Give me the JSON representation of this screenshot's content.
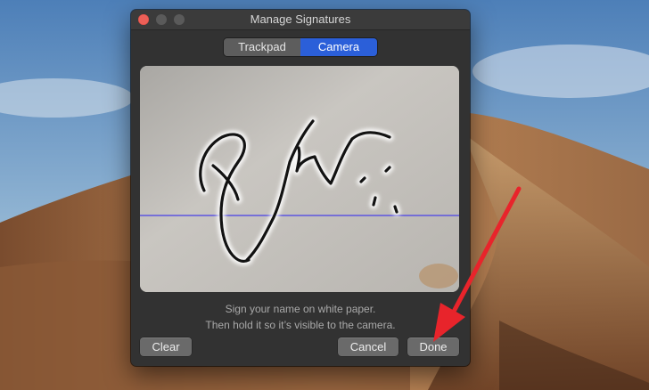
{
  "window": {
    "title": "Manage Signatures"
  },
  "tabs": [
    {
      "label": "Trackpad",
      "selected": false
    },
    {
      "label": "Camera",
      "selected": true
    }
  ],
  "instructions": {
    "line1": "Sign your name on white paper.",
    "line2": "Then hold it so it’s visible to the camera."
  },
  "buttons": {
    "clear": "Clear",
    "cancel": "Cancel",
    "done": "Done"
  },
  "colors": {
    "accent": "#2b5fd9",
    "close_button": "#ec5f57",
    "guide_line": "#5c55e0",
    "annotation_arrow": "#e8242b"
  },
  "signature_text": "Earth"
}
